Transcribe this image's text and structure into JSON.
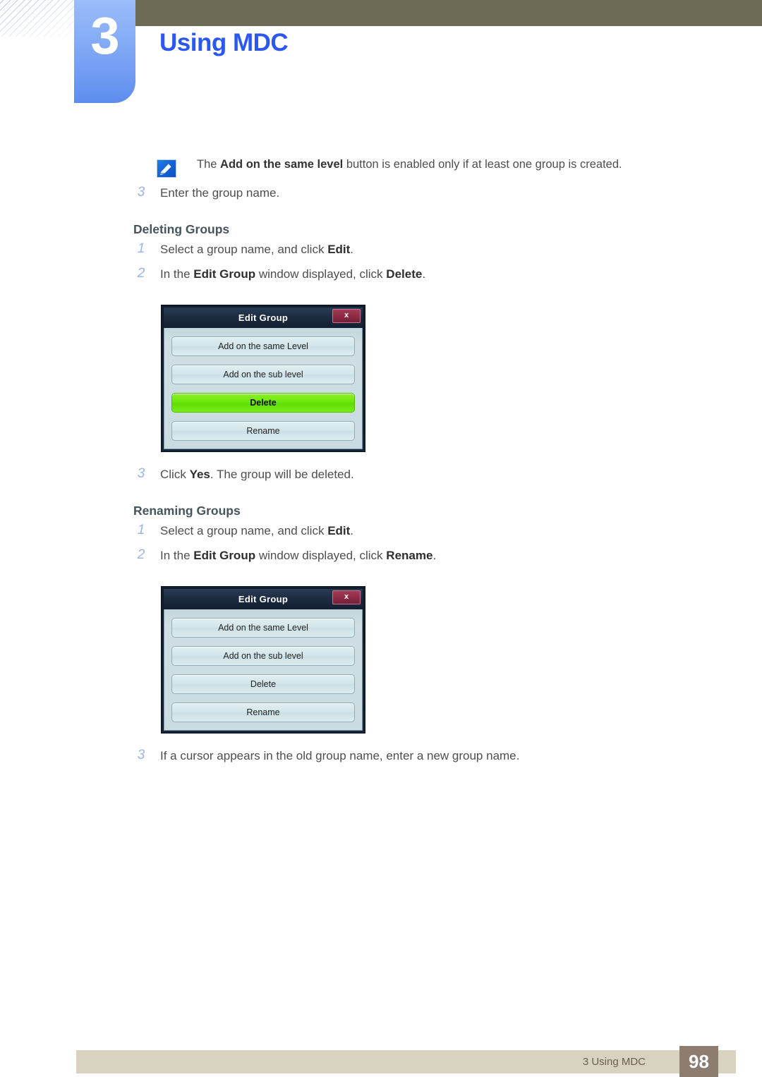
{
  "chapter": {
    "number": "3",
    "title": "Using MDC"
  },
  "colors": {
    "title_blue": "#2a58f0",
    "header_olive": "#6c6a55",
    "tab_blue": "#7ea8f6",
    "heading_slate": "#46545c",
    "step_number": "#9cb4e8",
    "footer_bar": "#d8d2c0",
    "footer_page_box": "#8c7d70",
    "dialog_highlight_green": "#6ee80a"
  },
  "note": {
    "icon": "note-pencil-icon",
    "text_before": "The ",
    "text_bold": "Add on the same level",
    "text_after": " button is enabled only if at least one group is created."
  },
  "steps_top": [
    {
      "index": "3",
      "text": "Enter the group name."
    }
  ],
  "sections": [
    {
      "heading": "Deleting Groups",
      "steps_before": [
        {
          "index": "1",
          "parts": [
            {
              "t": "Select a group name, and click ",
              "b": false
            },
            {
              "t": "Edit",
              "b": true
            },
            {
              "t": ".",
              "b": false
            }
          ]
        },
        {
          "index": "2",
          "parts": [
            {
              "t": "In the ",
              "b": false
            },
            {
              "t": "Edit Group",
              "b": true
            },
            {
              "t": " window displayed, click ",
              "b": false
            },
            {
              "t": "Delete",
              "b": true
            },
            {
              "t": ".",
              "b": false
            }
          ]
        }
      ],
      "dialog": {
        "title": "Edit Group",
        "close_label": "x",
        "buttons": [
          {
            "label": "Add on the same Level",
            "highlighted": false
          },
          {
            "label": "Add on the sub level",
            "highlighted": false
          },
          {
            "label": "Delete",
            "highlighted": true
          },
          {
            "label": "Rename",
            "highlighted": false
          }
        ]
      },
      "steps_after": [
        {
          "index": "3",
          "parts": [
            {
              "t": "Click ",
              "b": false
            },
            {
              "t": "Yes",
              "b": true
            },
            {
              "t": ". The group will be deleted.",
              "b": false
            }
          ]
        }
      ]
    },
    {
      "heading": "Renaming Groups",
      "steps_before": [
        {
          "index": "1",
          "parts": [
            {
              "t": "Select a group name, and click ",
              "b": false
            },
            {
              "t": "Edit",
              "b": true
            },
            {
              "t": ".",
              "b": false
            }
          ]
        },
        {
          "index": "2",
          "parts": [
            {
              "t": "In the ",
              "b": false
            },
            {
              "t": "Edit Group",
              "b": true
            },
            {
              "t": " window displayed, click ",
              "b": false
            },
            {
              "t": "Rename",
              "b": true
            },
            {
              "t": ".",
              "b": false
            }
          ]
        }
      ],
      "dialog": {
        "title": "Edit Group",
        "close_label": "x",
        "buttons": [
          {
            "label": "Add on the same Level",
            "highlighted": false
          },
          {
            "label": "Add on the sub level",
            "highlighted": false
          },
          {
            "label": "Delete",
            "highlighted": false
          },
          {
            "label": "Rename",
            "highlighted": false
          }
        ]
      },
      "steps_after": [
        {
          "index": "3",
          "parts": [
            {
              "t": "If a cursor appears in the old group name, enter a new group name.",
              "b": false
            }
          ]
        }
      ]
    }
  ],
  "footer": {
    "label": "3 Using MDC",
    "page_number": "98"
  }
}
